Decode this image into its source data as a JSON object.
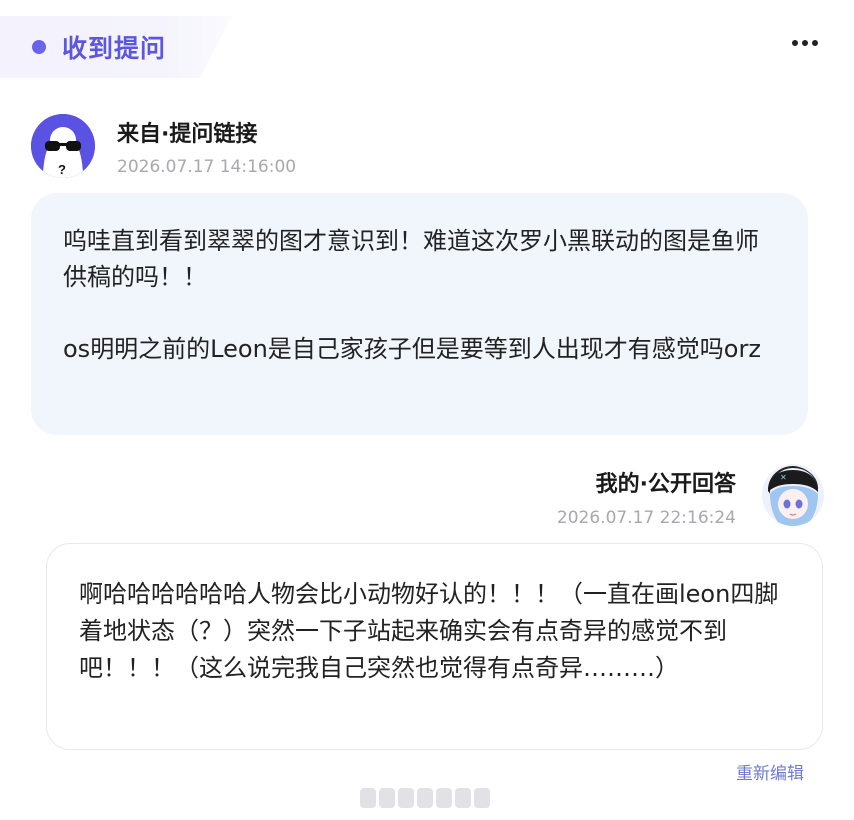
{
  "header": {
    "tag_label": "收到提问",
    "menu_icon": "more-horizontal-icon"
  },
  "question": {
    "sender": "来自·提问链接",
    "time": "2026.07.17 14:16:00",
    "avatar_icon": "anonymous-sunglasses-avatar",
    "paragraphs": [
      "呜哇直到看到翠翠的图才意识到！难道这次罗小黑联动的图是鱼师供稿的吗！！",
      "os明明之前的Leon是自己家孩子但是要等到人出现才有感觉吗orz"
    ]
  },
  "answer": {
    "label": "我的·公开回答",
    "time": "2026.07.17 22:16:24",
    "avatar_icon": "anime-girl-avatar",
    "text": "啊哈哈哈哈哈哈人物会比小动物好认的！！！（一直在画leon四脚着地状态（？）突然一下子站起来确实会有点奇异的感觉不到吧！！！（这么说完我自己突然也觉得有点奇异………）"
  },
  "actions": {
    "reedit": "重新编辑"
  },
  "colors": {
    "accent": "#5d56e0",
    "avatar_bg": "#5a52e2",
    "question_bubble": "#f1f5fc",
    "link": "#6f7ccd"
  }
}
